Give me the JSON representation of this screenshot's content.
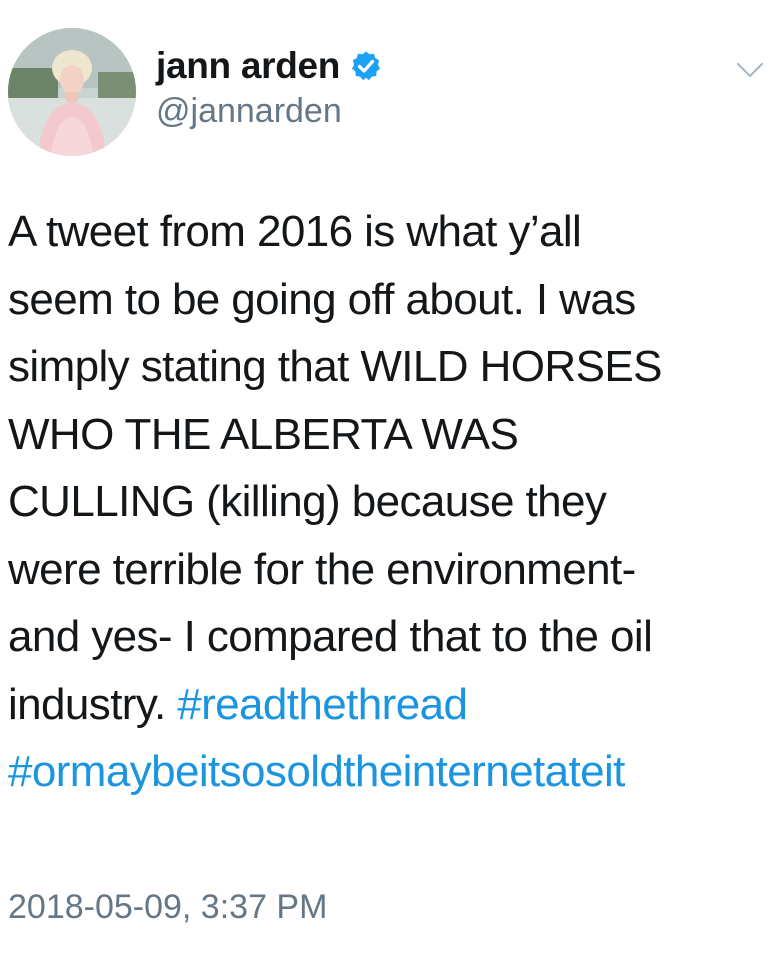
{
  "user": {
    "display_name": "jann arden",
    "handle": "@jannarden",
    "verified": true,
    "avatar_icon": "profile-photo"
  },
  "tweet": {
    "lines": [
      "A tweet from 2016 is what y’all",
      "seem to be going off about. I was",
      "simply stating that WILD HORSES",
      "WHO THE ALBERTA WAS",
      "CULLING (killing) because they",
      "were terrible for the environment-",
      "and yes- I compared that to the oil",
      "industry."
    ],
    "hashtags": [
      "#readthethread",
      "#ormaybeitsosoldtheinternetateit"
    ],
    "timestamp": "2018-05-09, 3:37 PM"
  },
  "icons": {
    "verified": "verified-badge-icon",
    "menu": "chevron-down-icon"
  },
  "colors": {
    "text": "#14171a",
    "secondary": "#657786",
    "hashtag": "#1b95e0",
    "verified": "#1da1f2"
  }
}
